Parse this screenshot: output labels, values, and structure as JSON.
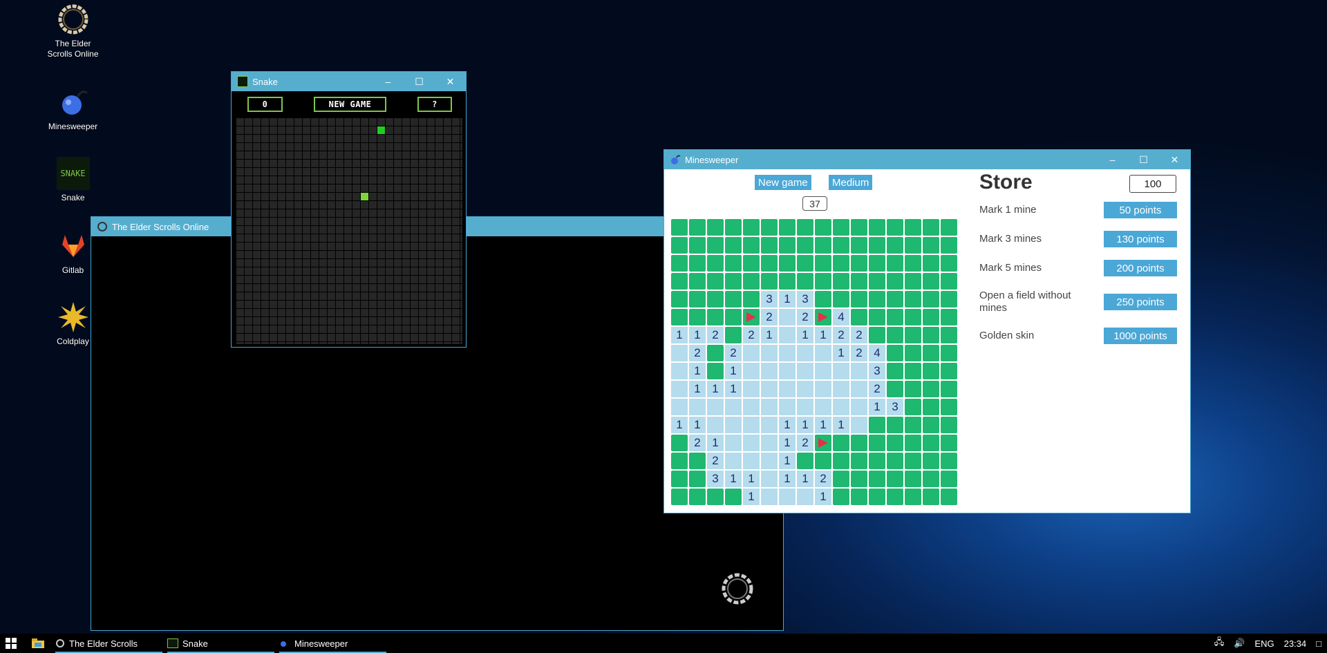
{
  "desktop": {
    "icons": [
      {
        "label": "The Elder Scrolls Online",
        "icon": "eso-ring-icon"
      },
      {
        "label": "Minesweeper",
        "icon": "bomb-icon"
      },
      {
        "label": "Snake",
        "icon": "snake-icon",
        "icon_text": "SNAKE"
      },
      {
        "label": "Gitlab",
        "icon": "gitlab-icon"
      },
      {
        "label": "Coldplay",
        "icon": "star-burst-icon"
      }
    ]
  },
  "eso_window": {
    "title": "The Elder Scrolls Online"
  },
  "snake_window": {
    "title": "Snake",
    "score": "0",
    "new_game_label": "NEW GAME",
    "help_label": "?",
    "cells": [
      {
        "col": 17,
        "row": 1,
        "color": "#22cc22"
      },
      {
        "col": 15,
        "row": 9,
        "color": "#7dd63a"
      }
    ]
  },
  "minesweeper_window": {
    "title": "Minesweeper",
    "new_game_label": "New game",
    "difficulty_label": "Medium",
    "mines_left": "37",
    "board": [
      "cccccccccccccccc",
      "cccccccccccccccc",
      "cccccccccccccccc",
      "cccccccccccccccc",
      "ccccc313cccccccc",
      "ccccF2o2F4cccccc",
      "112c21o1122ccccc",
      "o2c2oooo0124cccc",
      "o1c1ooooooo3cccc",
      "o111ooooooo2cccc",
      "ooooooooooo13ccc",
      "11oooo1111occccc",
      "c21ooo12Fccccccc",
      "cc2ooo1ccccccccc",
      "cc311o112ccccccc",
      "cccc1ooo1ccccccc"
    ],
    "store": {
      "title": "Store",
      "points": "100",
      "items": [
        {
          "label": "Mark 1 mine",
          "price": "50 points"
        },
        {
          "label": "Mark 3 mines",
          "price": "130 points"
        },
        {
          "label": "Mark 5 mines",
          "price": "200 points"
        },
        {
          "label": "Open a field without mines",
          "price": "250 points"
        },
        {
          "label": "Golden skin",
          "price": "1000 points"
        }
      ]
    }
  },
  "taskbar": {
    "items": [
      {
        "label": "The Elder Scrolls",
        "icon": "eso-ring-icon"
      },
      {
        "label": "Snake",
        "icon": "snake-icon"
      },
      {
        "label": "Minesweeper",
        "icon": "bomb-icon"
      }
    ],
    "language": "ENG",
    "time": "23:34"
  },
  "colors": {
    "titlebar": "#56aecf",
    "covered_tile": "#1fb870",
    "open_tile": "#b4dced",
    "accent_button": "#4aa7d6"
  }
}
